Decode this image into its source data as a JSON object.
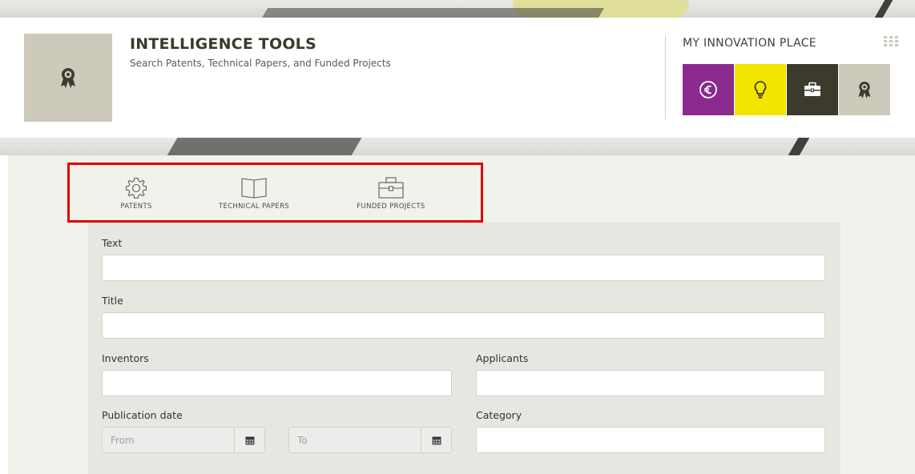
{
  "header": {
    "title": "INTELLIGENCE TOOLS",
    "subtitle": "Search Patents, Technical Papers, and Funded Projects"
  },
  "innovation_place": {
    "title": "MY INNOVATION PLACE",
    "tiles": [
      {
        "icon": "euro-icon",
        "color": "#8b2a8f"
      },
      {
        "icon": "lightbulb-icon",
        "color": "#f2e600"
      },
      {
        "icon": "briefcase-icon",
        "color": "#3c3a2c"
      },
      {
        "icon": "award-icon",
        "color": "#cdc9bb"
      }
    ]
  },
  "type_tabs": [
    {
      "label": "PATENTS",
      "icon": "gear-icon"
    },
    {
      "label": "TECHNICAL PAPERS",
      "icon": "book-icon"
    },
    {
      "label": "FUNDED PROJECTS",
      "icon": "briefcase-icon"
    }
  ],
  "form": {
    "text_label": "Text",
    "text_value": "",
    "title_label": "Title",
    "title_value": "",
    "inventors_label": "Inventors",
    "inventors_value": "",
    "applicants_label": "Applicants",
    "applicants_value": "",
    "publication_date_label": "Publication date",
    "from_placeholder": "From",
    "to_placeholder": "To",
    "category_label": "Category",
    "category_value": ""
  },
  "colors": {
    "highlight": "#e00000",
    "panel": "#e7e7e1",
    "logo_tile": "#cdc9bb"
  }
}
